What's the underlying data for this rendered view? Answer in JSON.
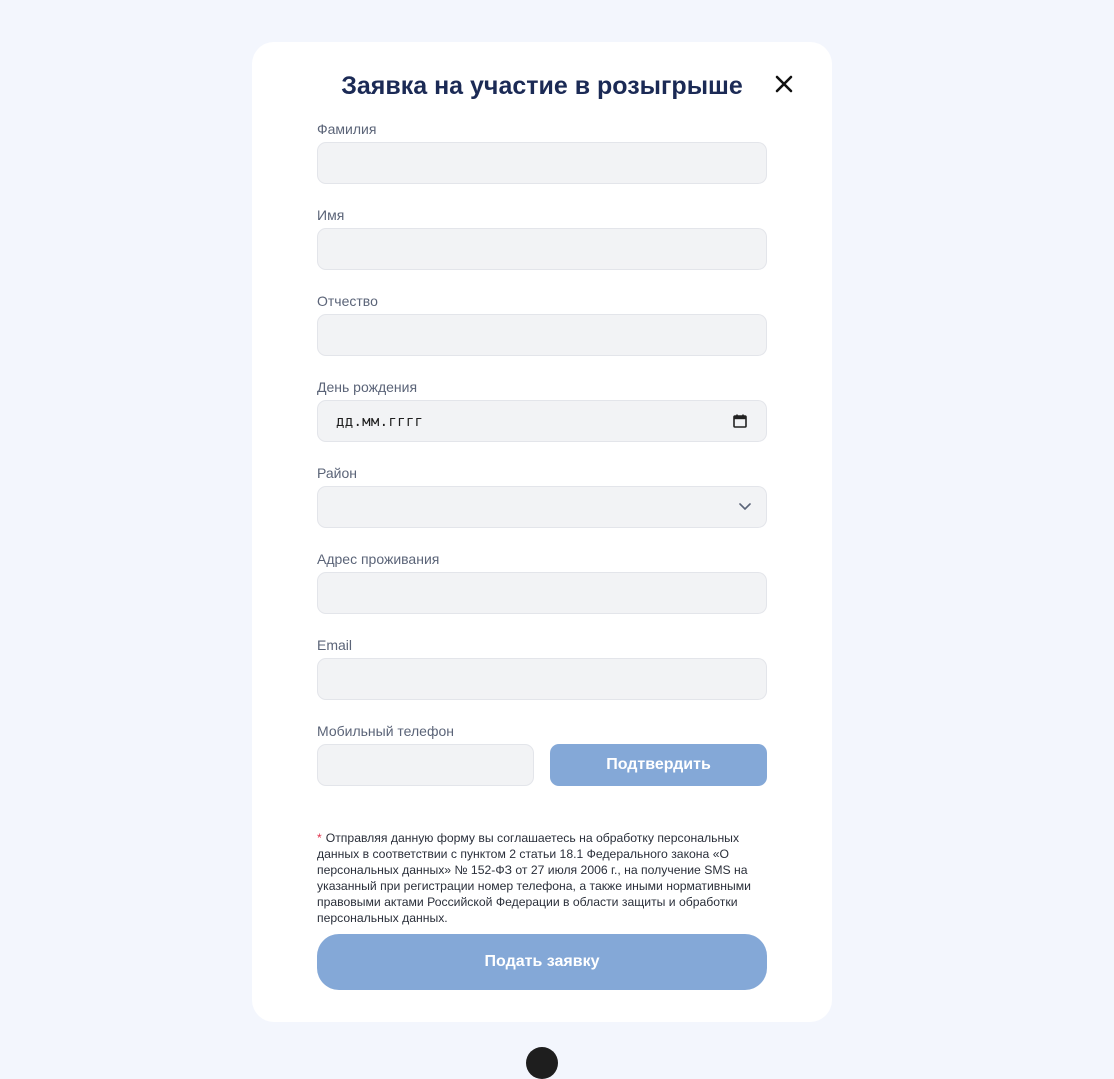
{
  "form": {
    "title": "Заявка на участие в розыгрыше",
    "fields": {
      "last_name": {
        "label": "Фамилия",
        "value": ""
      },
      "first_name": {
        "label": "Имя",
        "value": ""
      },
      "patronymic": {
        "label": "Отчество",
        "value": ""
      },
      "birthday": {
        "label": "День рождения",
        "placeholder": "дд.мм.гггг"
      },
      "district": {
        "label": "Район",
        "value": ""
      },
      "address": {
        "label": "Адрес проживания",
        "value": ""
      },
      "email": {
        "label": "Email",
        "value": ""
      },
      "phone": {
        "label": "Мобильный телефон",
        "value": ""
      }
    },
    "confirm_label": "Подтвердить",
    "consent_asterisk": "*",
    "consent_text": "Отправляя данную форму вы соглашаетесь на обработку персональных данных в соответствии с пунктом 2 статьи 18.1 Федерального закона «О персональных данных» № 152-ФЗ от 27 июля 2006 г., на получение SMS на указанный при регистрации номер телефона, а также иными нормативными правовыми актами Российской Федерации в области защиты и обработки персональных данных.",
    "submit_label": "Подать заявку"
  },
  "icons": {
    "close": "close-icon",
    "calendar": "calendar-icon",
    "dropdown": "chevron-down-icon"
  },
  "colors": {
    "page_background": "#f3f6fd",
    "title": "#1b2a55",
    "button": "#84a8d7",
    "asterisk": "#e0334c"
  }
}
